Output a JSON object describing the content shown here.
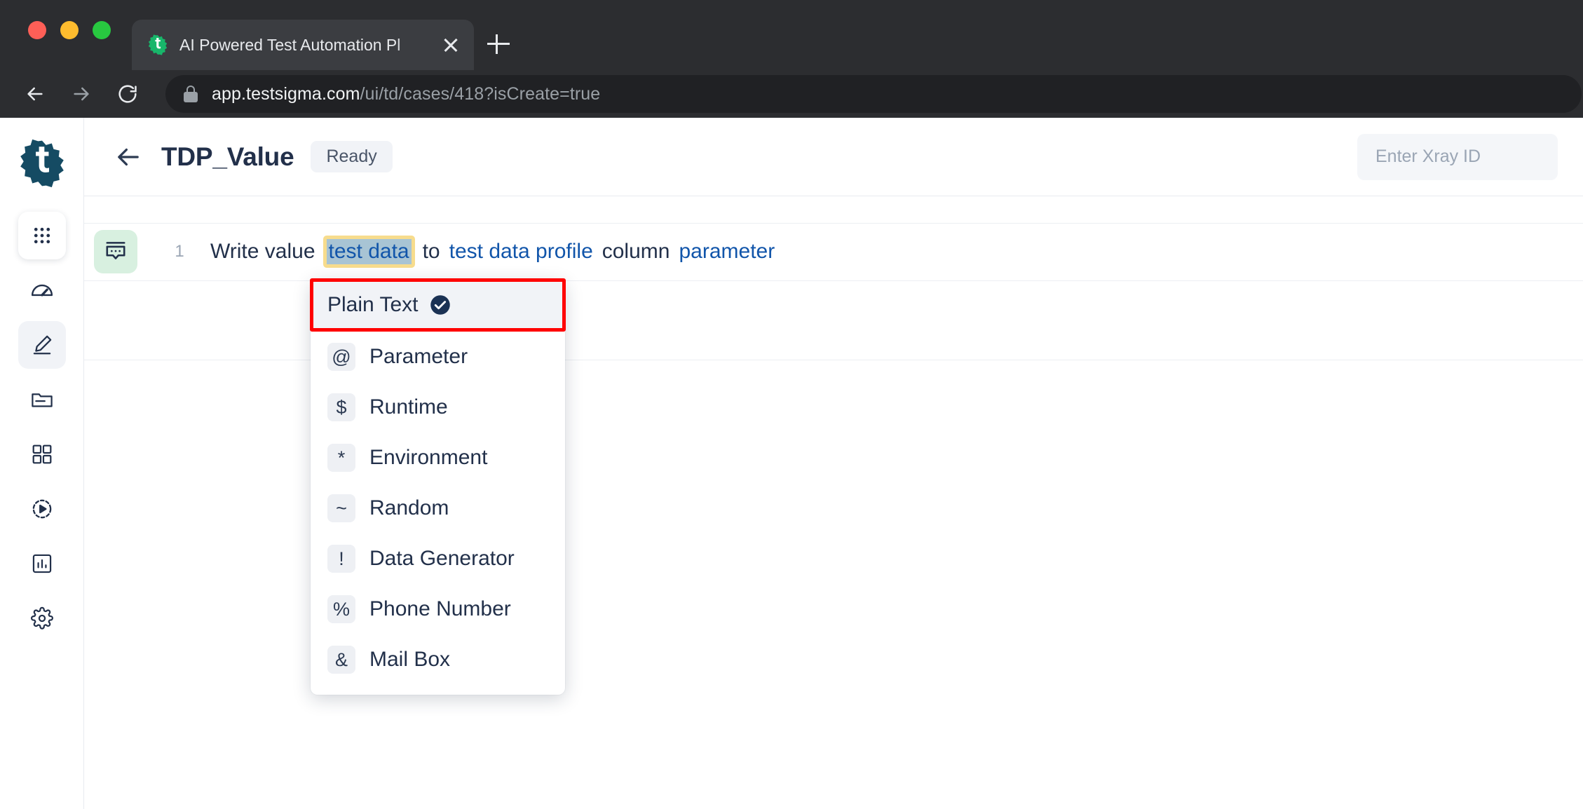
{
  "browser": {
    "tab": {
      "title": "AI Powered Test Automation Pl",
      "favicon_name": "testsigma-favicon"
    },
    "new_tab_label": "+",
    "toolbar": {
      "back_label": "Back",
      "forward_label": "Forward",
      "reload_label": "Reload"
    },
    "address": {
      "host": "app.testsigma.com",
      "path": "/ui/td/cases/418?isCreate=true",
      "full_url": "app.testsigma.com/ui/td/cases/418?isCreate=true",
      "secure": true
    }
  },
  "sidebar": {
    "brand": "testsigma-logo",
    "items": [
      {
        "name": "apps-grid",
        "icon": "apps-grid-icon",
        "active": false,
        "card": true
      },
      {
        "name": "dashboard",
        "icon": "speedometer-icon",
        "active": false,
        "card": false
      },
      {
        "name": "test-cases",
        "icon": "pencil-icon",
        "active": true,
        "card": false
      },
      {
        "name": "test-data",
        "icon": "folder-icon",
        "active": false,
        "card": false
      },
      {
        "name": "test-suites",
        "icon": "squares-icon",
        "active": false,
        "card": false
      },
      {
        "name": "test-plans",
        "icon": "play-circle-icon",
        "active": false,
        "card": false
      },
      {
        "name": "reports",
        "icon": "bar-chart-icon",
        "active": false,
        "card": false
      },
      {
        "name": "settings",
        "icon": "gear-icon",
        "active": false,
        "card": false
      }
    ]
  },
  "header": {
    "back_label": "Back",
    "title": "TDP_Value",
    "status": "Ready",
    "xray": {
      "placeholder": "Enter Xray ID",
      "value": ""
    }
  },
  "step": {
    "index": "1",
    "icon_name": "natural-language-step-icon",
    "tokens": {
      "t1": "Write value",
      "t2": "test data",
      "t3": "to",
      "t4": "test data profile",
      "t5": "column",
      "t6": "parameter"
    }
  },
  "dropdown": {
    "selected": {
      "label": "Plain Text",
      "checked": true
    },
    "highlight_color": "#ff0000",
    "items": [
      {
        "symbol": "@",
        "label": "Parameter"
      },
      {
        "symbol": "$",
        "label": "Runtime"
      },
      {
        "symbol": "*",
        "label": "Environment"
      },
      {
        "symbol": "~",
        "label": "Random"
      },
      {
        "symbol": "!",
        "label": "Data Generator"
      },
      {
        "symbol": "%",
        "label": "Phone Number"
      },
      {
        "symbol": "&",
        "label": "Mail Box"
      }
    ]
  },
  "colors": {
    "brand_navy": "#1b4257",
    "link_blue": "#1155aa",
    "text_navy": "#22304a",
    "selection_bg": "#a8c4d4",
    "selection_border": "#f7dc8d",
    "step_icon_bg": "#d8f0e0",
    "annotation_red": "#ff0000",
    "chrome_bg": "#2c2d30"
  }
}
